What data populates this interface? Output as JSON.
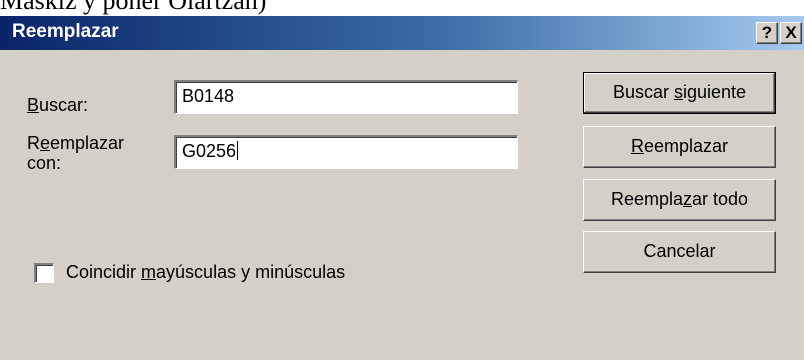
{
  "background_caption": "Maskiz y poner Olartzan)",
  "dialog": {
    "title": "Reemplazar",
    "help_button": "?",
    "close_button": "X",
    "find_label": {
      "pre": "",
      "accel": "B",
      "post": "uscar:"
    },
    "find_value": "B0148",
    "replace_label": {
      "pre": "R",
      "accel": "e",
      "post": "emplazar",
      "line2": "con:"
    },
    "replace_value": "G0256",
    "match_case": {
      "checked": false,
      "label": {
        "pre": "Coincidir ",
        "accel": "m",
        "post": "ayúsculas y minúsculas"
      }
    },
    "buttons": {
      "find_next": {
        "pre": "Buscar ",
        "accel": "s",
        "post": "iguiente"
      },
      "replace": {
        "pre": "",
        "accel": "R",
        "post": "eemplazar"
      },
      "replace_all": {
        "pre": "Reempla",
        "accel": "z",
        "post": "ar todo"
      },
      "cancel": {
        "pre": "Cancelar",
        "accel": "",
        "post": ""
      }
    }
  },
  "colors": {
    "titlebar_start": "#0a246a",
    "titlebar_end": "#a6caf0",
    "face": "#d4d0c8"
  }
}
